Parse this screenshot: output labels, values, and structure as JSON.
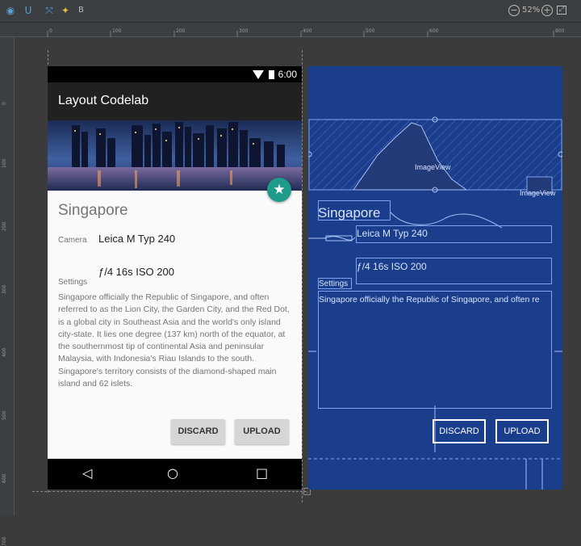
{
  "toolbar": {
    "b_label": "B",
    "zoom_out": "−",
    "zoom_level": "52%",
    "zoom_in": "+"
  },
  "rulers": {
    "top": [
      "0",
      "100",
      "200",
      "300",
      "400",
      "500",
      "600",
      "800"
    ],
    "left": [
      "0",
      "100",
      "200",
      "300",
      "400",
      "500",
      "600",
      "700"
    ]
  },
  "phone": {
    "status_time": "6:00",
    "app_title": "Layout Codelab",
    "city": "Singapore",
    "camera_label": "Camera",
    "camera_value": "Leica M Typ 240",
    "settings_label": "Settings",
    "settings_value": "ƒ/4 16s ISO 200",
    "description": "Singapore officially the Republic of Singapore, and often referred to as the Lion City, the Garden City, and the Red Dot, is a global city in Southeast Asia and the world's only island city-state. It lies one degree (137 km) north of the equator, at the southernmost tip of continental Asia and peninsular Malaysia, with Indonesia's Riau Islands to the south. Singapore's territory consists of the diamond-shaped main island and 62 islets.",
    "discard": "DISCARD",
    "upload": "UPLOAD"
  },
  "blueprint": {
    "imageview_main": "ImageView",
    "imageview_fab": "ImageView",
    "city": "Singapore",
    "camera_value": "Leica M Typ 240",
    "settings_value": "ƒ/4 16s ISO 200",
    "settings_label": "Settings",
    "description": "Singapore officially the Republic of Singapore, and often re",
    "discard": "DISCARD",
    "upload": "UPLOAD"
  },
  "colors": {
    "accent": "#1e9b8a",
    "blueprint_bg": "#1a3e8c",
    "app_bar": "#212121"
  },
  "icons": [
    "eye-icon",
    "magnet-icon",
    "transform-icon",
    "bulb-icon",
    "wifi-icon",
    "battery-icon",
    "star-icon",
    "back-icon",
    "home-icon",
    "recents-icon"
  ]
}
